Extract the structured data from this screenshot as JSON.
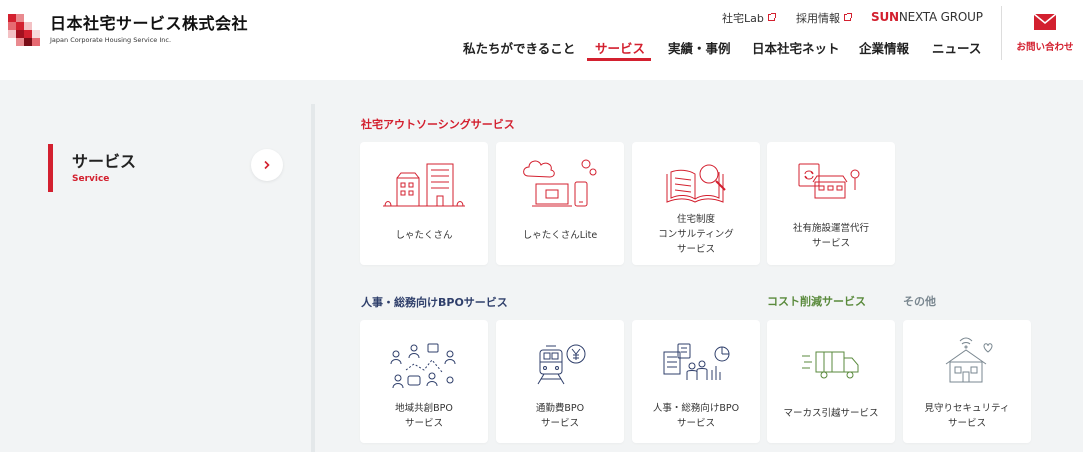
{
  "header": {
    "logo_ja": "日本社宅サービス株式会社",
    "logo_en": "Japan Corporate Housing Service Inc.",
    "util_links": [
      "社宅Lab",
      "採用情報"
    ],
    "group_brand_bold": "SUN",
    "group_brand_rest": "NEXTA GROUP",
    "nav": [
      {
        "label": "私たちができること"
      },
      {
        "label": "サービス",
        "active": true
      },
      {
        "label": "実績・事例"
      },
      {
        "label": "日本社宅ネット"
      },
      {
        "label": "企業情報"
      },
      {
        "label": "ニュース"
      }
    ],
    "contact_label": "お問い合わせ"
  },
  "sidebar": {
    "title": "サービス",
    "subtitle": "Service"
  },
  "sections": {
    "outsourcing": "社宅アウトソーシングサービス",
    "bpo": "人事・総務向けBPOサービス",
    "cost": "コスト削減サービス",
    "other": "その他"
  },
  "cards_row1": [
    {
      "label": "しゃたくさん",
      "icon": "buildings-icon"
    },
    {
      "label": "しゃたくさんLite",
      "icon": "cloud-computer-icon"
    },
    {
      "label": "住宅制度\nコンサルティング\nサービス",
      "icon": "book-magnifier-icon"
    },
    {
      "label": "社有施設運営代行\nサービス",
      "icon": "facility-management-icon"
    }
  ],
  "cards_row2": [
    {
      "label": "地域共創BPO\nサービス",
      "icon": "community-network-icon"
    },
    {
      "label": "通勤費BPO\nサービス",
      "icon": "train-yen-icon"
    },
    {
      "label": "人事・総務向けBPO\nサービス",
      "icon": "office-staff-icon"
    },
    {
      "label": "マーカス引越サービス",
      "icon": "moving-truck-icon"
    },
    {
      "label": "見守りセキュリティ\nサービス",
      "icon": "home-security-icon"
    }
  ],
  "colors": {
    "brand_red": "#d3202f",
    "bpo_navy": "#2f3f6b",
    "cost_green": "#5a8a3c",
    "other_gray": "#7a8790",
    "background": "#f2f4f5"
  }
}
